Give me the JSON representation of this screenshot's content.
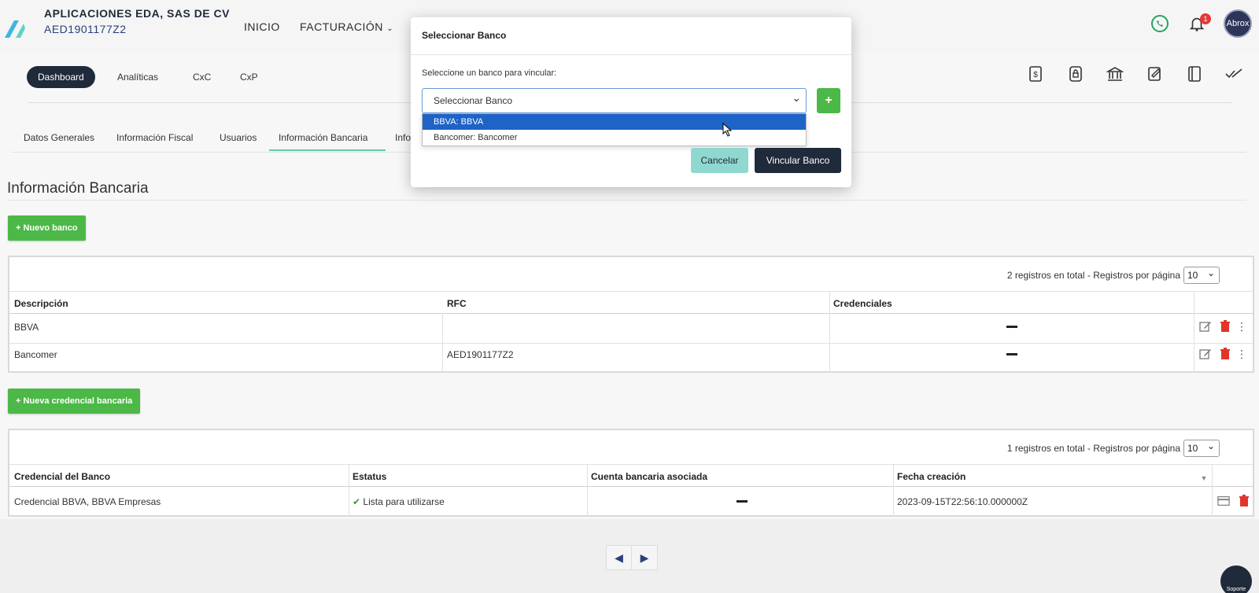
{
  "header": {
    "company_name": "APLICACIONES EDA, SAS DE CV",
    "company_rfc": "AED1901177Z2",
    "nav": [
      "INICIO",
      "FACTURACIÓN"
    ],
    "notification_count": "1",
    "avatar_text": "Abrox"
  },
  "main_nav": [
    "Dashboard",
    "Analíticas",
    "CxC",
    "CxP"
  ],
  "subtabs": [
    "Datos Generales",
    "Información Fiscal",
    "Usuarios",
    "Información Bancaria",
    "Info"
  ],
  "section_title": "Información Bancaria",
  "new_bank_button": "+ Nuevo banco",
  "banks_table": {
    "info": "2 registros en total - Registros por página",
    "per_page": "10",
    "headers": [
      "Descripción",
      "RFC",
      "Credenciales"
    ],
    "rows": [
      {
        "descripcion": "BBVA",
        "rfc": ""
      },
      {
        "descripcion": "Bancomer",
        "rfc": "AED1901177Z2"
      }
    ]
  },
  "new_credential_button": "+ Nueva credencial bancaria",
  "credentials_table": {
    "info": "1 registros en total - Registros por página",
    "per_page": "10",
    "headers": [
      "Credencial del Banco",
      "Estatus",
      "Cuenta bancaria asociada",
      "Fecha creación"
    ],
    "rows": [
      {
        "credencial": "Credencial BBVA, BBVA Empresas",
        "estatus": "Lista para utilizarse",
        "fecha": "2023-09-15T22:56:10.000000Z"
      }
    ]
  },
  "pager": {
    "prev": "◀",
    "next": "▶"
  },
  "support_label": "Soporte",
  "modal": {
    "title": "Seleccionar Banco",
    "label": "Seleccione un banco para vincular:",
    "select_placeholder": "Seleccionar Banco",
    "options": [
      "BBVA: BBVA",
      "Bancomer: Bancomer"
    ],
    "plus": "+",
    "cancel": "Cancelar",
    "link": "Vincular Banco"
  },
  "colors": {
    "accent_green": "#4cb847",
    "dark": "#1f2a3a",
    "teal": "#8fd8cf",
    "select_blue": "#1e63c6"
  }
}
